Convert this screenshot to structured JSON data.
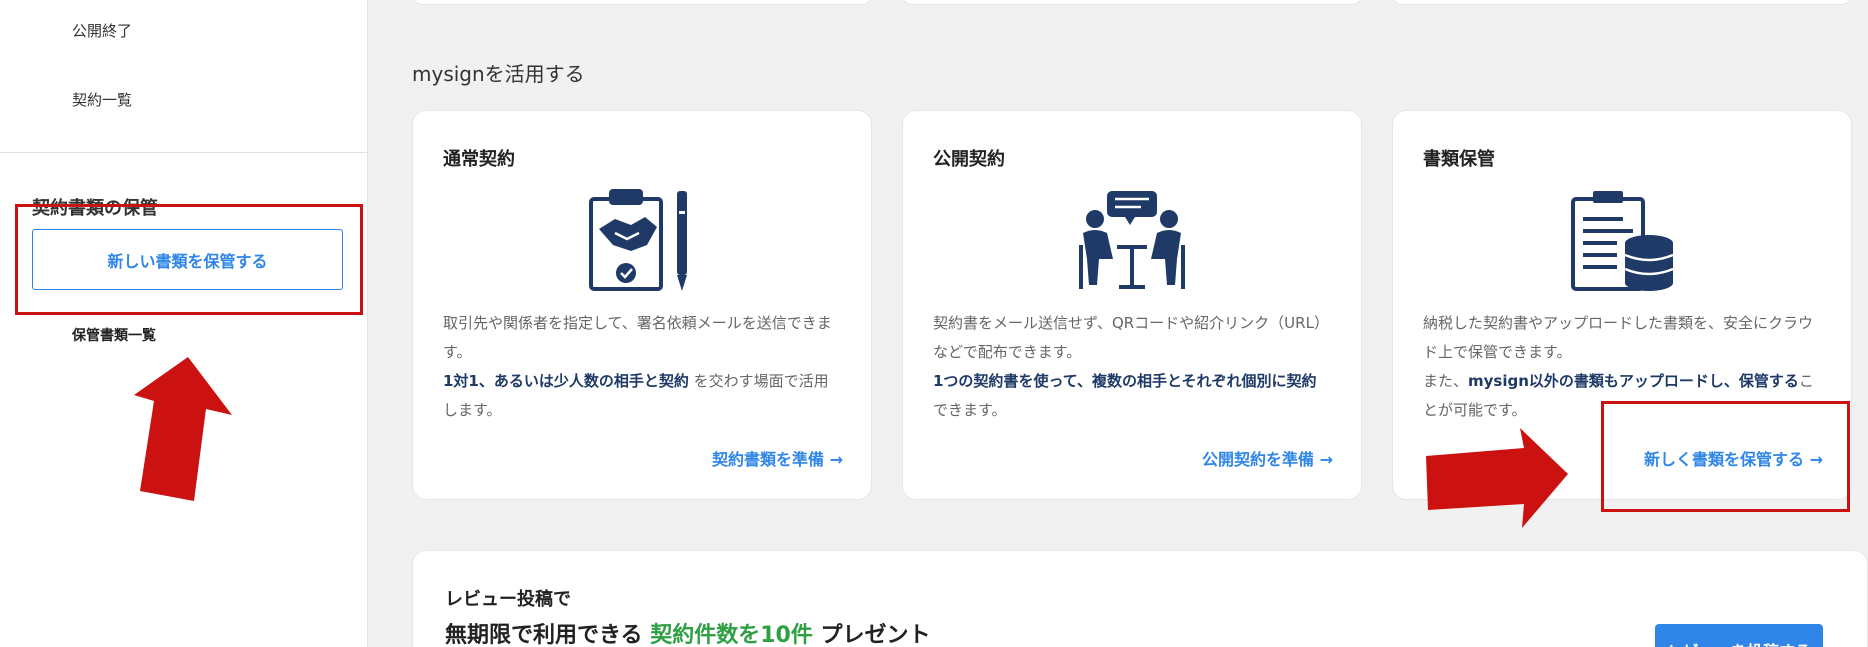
{
  "sidebar": {
    "items": [
      {
        "label": "公開終了"
      },
      {
        "label": "契約一覧"
      }
    ],
    "storage_section": {
      "title": "契約書類の保管",
      "new_button": "新しい書類を保管する",
      "list_link": "保管書類一覧"
    }
  },
  "main": {
    "section_title": "mysignを活用する",
    "cards": [
      {
        "title": "通常契約",
        "icon": "handshake-clipboard-icon",
        "desc_plain_1": "取引先や関係者を指定して、署名依頼メールを送信できます。",
        "desc_bold": "1対1、あるいは少人数の相手と契約",
        "desc_plain_2": "を交わす場面で活用します。",
        "link": "契約書類を準備 →"
      },
      {
        "title": "公開契約",
        "icon": "meeting-people-icon",
        "desc_plain_1": "契約書をメール送信せず、QRコードや紹介リンク（URL）などで配布できます。",
        "desc_bold": "1つの契約書を使って、複数の相手とそれぞれ個別に契約",
        "desc_plain_2": "できます。",
        "link": "公開契約を準備 →"
      },
      {
        "title": "書類保管",
        "icon": "clipboard-database-icon",
        "desc_plain_1": "納税した契約書やアップロードした書類を、安全にクラウド上で保管できます。",
        "desc_pre_2": "また、",
        "desc_bold": "mysign以外の書類もアップロードし、保管する",
        "desc_plain_2": "ことが可能です。",
        "link": "新しく書類を保管する →"
      }
    ]
  },
  "review": {
    "pre": "レビュー投稿で",
    "main_1": "無期限で利用できる ",
    "main_green": "契約件数を10件",
    "main_2": " プレゼント",
    "button": "レビューを投稿する"
  },
  "colors": {
    "accent": "#2f86e8",
    "navy": "#1f3a66",
    "highlight": "#cc1111",
    "green": "#2ea043"
  }
}
